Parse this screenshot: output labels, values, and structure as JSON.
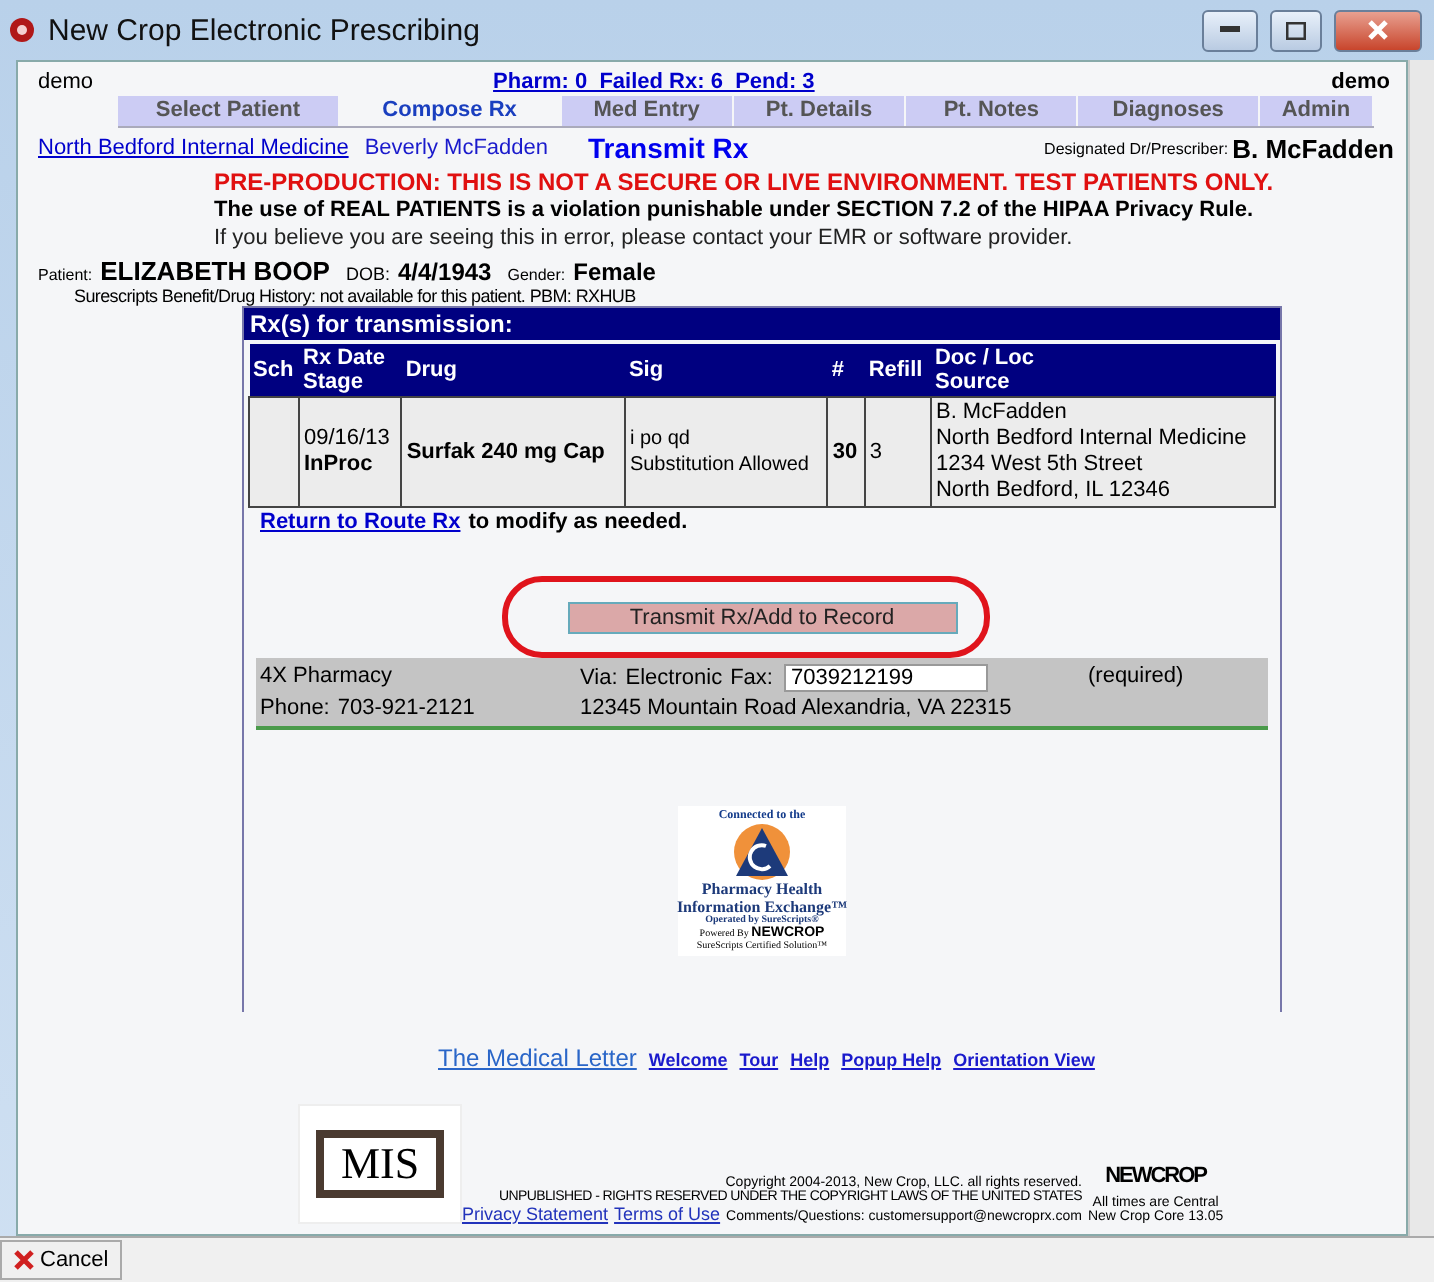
{
  "window": {
    "title": "New Crop Electronic Prescribing"
  },
  "header": {
    "user_left": "demo",
    "status_link": "Pharm: 0  Failed Rx: 6  Pend: 3",
    "user_right": "demo"
  },
  "tabs": [
    {
      "label": "Select Patient",
      "selected": false
    },
    {
      "label": "Compose Rx",
      "selected": true
    },
    {
      "label": "Med Entry",
      "selected": false
    },
    {
      "label": "Pt. Details",
      "selected": false
    },
    {
      "label": "Pt. Notes",
      "selected": false
    },
    {
      "label": "Diagnoses",
      "selected": false
    },
    {
      "label": "Admin",
      "selected": false
    }
  ],
  "context": {
    "practice_link": "North Bedford Internal Medicine",
    "provider": "Beverly McFadden",
    "page_title": "Transmit Rx",
    "prescriber_label": "Designated Dr/Prescriber:",
    "prescriber": "B. McFadden"
  },
  "warnings": [
    "PRE-PRODUCTION: THIS IS NOT A SECURE OR LIVE ENVIRONMENT. TEST PATIENTS ONLY.",
    "The use of REAL PATIENTS is a violation punishable under SECTION 7.2 of the HIPAA Privacy Rule.",
    "If you believe you are seeing this in error, please contact your EMR or software provider."
  ],
  "patient": {
    "name_label": "Patient:",
    "name": "ELIZABETH BOOP",
    "dob_label": "DOB:",
    "dob": "4/4/1943",
    "gender_label": "Gender:",
    "gender": "Female",
    "history_note": "Surescripts Benefit/Drug History: not available for this patient. PBM: RXHUB"
  },
  "rx_panel": {
    "title": "Rx(s) for transmission:",
    "columns": [
      "Sch",
      "Rx Date\nStage",
      "Drug",
      "Sig",
      "#",
      "Refill",
      "Doc / Loc\nSource"
    ],
    "rows": [
      {
        "sch": "",
        "date": "09/16/13",
        "stage": "InProc",
        "drug": "Surfak 240 mg Cap",
        "sig": "i po qd",
        "sig_note": "Substitution Allowed",
        "qty": "30",
        "refill": "3",
        "source": [
          "B. McFadden",
          "North Bedford Internal Medicine",
          "1234 West 5th Street",
          "North Bedford, IL 12346"
        ]
      }
    ],
    "return_link": "Return to Route Rx",
    "return_text": "to modify as needed.",
    "transmit_button": "Transmit Rx/Add to Record",
    "pharmacy": {
      "name": "4X Pharmacy",
      "via_label": "Via:",
      "via": "Electronic",
      "fax_label": "Fax:",
      "fax": "7039212199",
      "required": "(required)",
      "phone_label": "Phone:",
      "phone": "703-921-2121",
      "address": "12345 Mountain Road Alexandria, VA 22315"
    },
    "badge": {
      "top": "Connected to the",
      "line1": "Pharmacy Health",
      "line2": "Information Exchange",
      "tm": "™",
      "operated": "Operated by SureScripts®",
      "powered": "Powered By",
      "brand": "NEWCROP",
      "certified": "SureScripts Certified Solution™"
    }
  },
  "links": [
    {
      "label": "The Medical Letter",
      "kind": "large"
    },
    {
      "label": "Welcome",
      "kind": "small"
    },
    {
      "label": "Tour",
      "kind": "small"
    },
    {
      "label": "Help",
      "kind": "small"
    },
    {
      "label": "Popup Help",
      "kind": "small"
    },
    {
      "label": "Orientation View",
      "kind": "small"
    }
  ],
  "footer": {
    "logo": "MIS",
    "copyright": "Copyright 2004-2013, New Crop, LLC. all rights reserved.",
    "unpublished": "UNPUBLISHED - RIGHTS RESERVED UNDER THE COPYRIGHT LAWS OF THE UNITED STATES",
    "privacy_link": "Privacy Statement",
    "terms_link": "Terms of Use",
    "contact": "Comments/Questions: customersupport@newcroprx.com",
    "brand": "NEWCROP",
    "times": "All times are Central",
    "version": "New Crop Core 13.05"
  },
  "status_bar": {
    "cancel": "Cancel"
  }
}
